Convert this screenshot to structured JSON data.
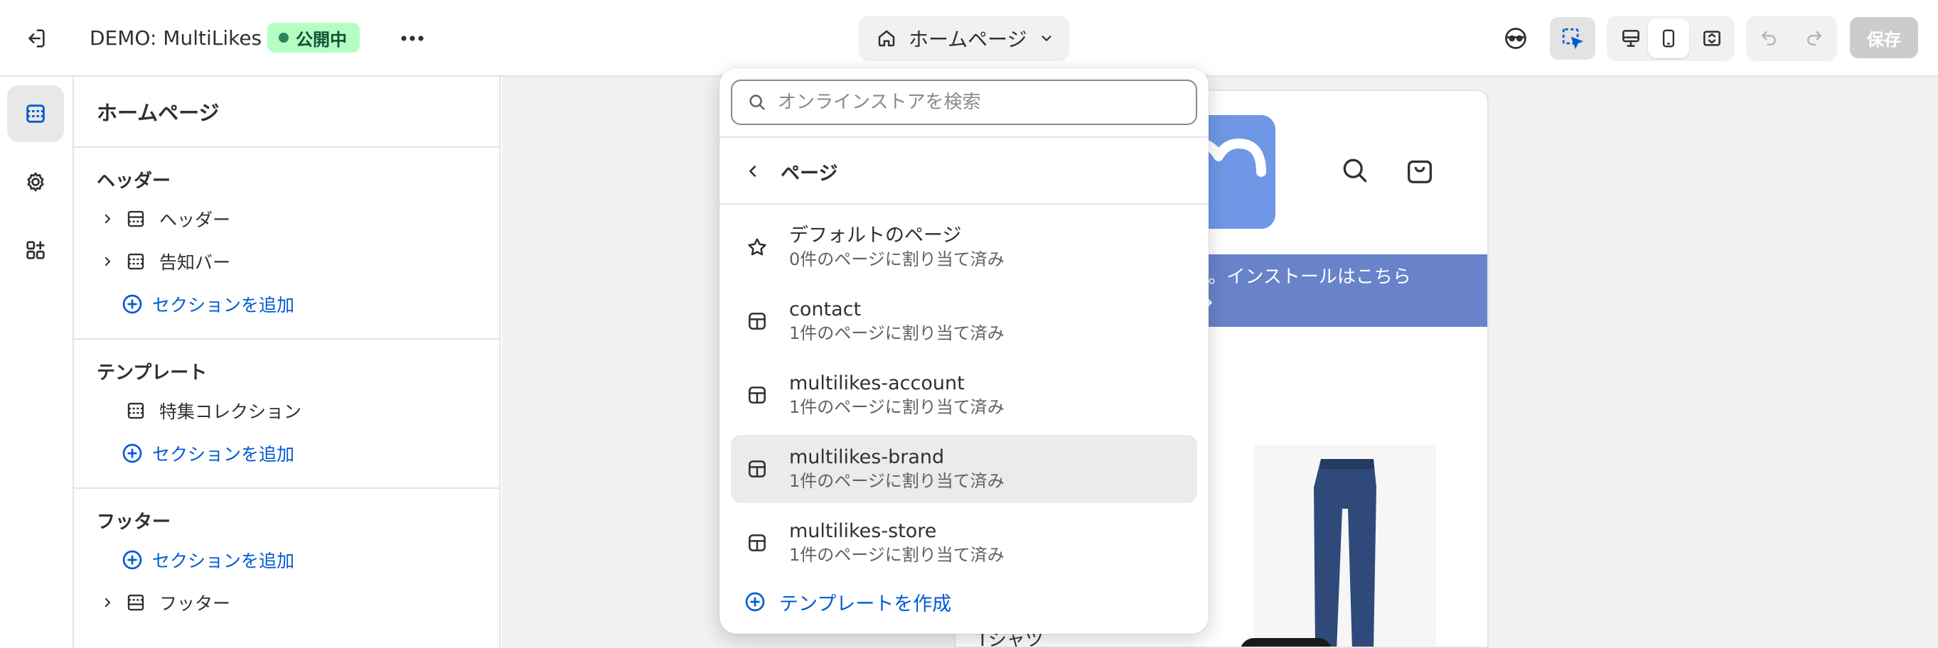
{
  "topbar": {
    "store_name": "DEMO: MultiLikes",
    "status_badge": "公開中",
    "page_selector_label": "ホームページ",
    "save_label": "保存"
  },
  "sidebar": {
    "title": "ホームページ",
    "sections": [
      {
        "title": "ヘッダー",
        "items": [
          "ヘッダー",
          "告知バー"
        ],
        "add_label": "セクションを追加"
      },
      {
        "title": "テンプレート",
        "items": [
          "特集コレクション"
        ],
        "add_label": "セクションを追加"
      },
      {
        "title": "フッター",
        "items": [
          "フッター"
        ],
        "add_label": "セクションを追加"
      }
    ]
  },
  "dropdown": {
    "search_placeholder": "オンラインストアを検索",
    "back_label": "ページ",
    "items": [
      {
        "name": "デフォルトのページ",
        "subtitle": "0件のページに割り当て済み",
        "icon": "star-icon"
      },
      {
        "name": "contact",
        "subtitle": "1件のページに割り当て済み",
        "icon": "template-icon"
      },
      {
        "name": "multilikes-account",
        "subtitle": "1件のページに割り当て済み",
        "icon": "template-icon"
      },
      {
        "name": "multilikes-brand",
        "subtitle": "1件のページに割り当て済み",
        "icon": "template-icon",
        "selected": true
      },
      {
        "name": "multilikes-store",
        "subtitle": "1件のページに割り当て済み",
        "icon": "template-icon"
      }
    ],
    "create_label": "テンプレートを作成"
  },
  "preview": {
    "banner_line1": "です。インストールはこちら",
    "banner_line2": "ら →",
    "product_label": "Tシャツ"
  },
  "colors": {
    "accent": "#005bd3",
    "badge_bg": "#b4fec4",
    "badge_text": "#0c5132",
    "banner": "#6883c9",
    "logo": "#6e98e6",
    "save_disabled": "#cccccc"
  }
}
